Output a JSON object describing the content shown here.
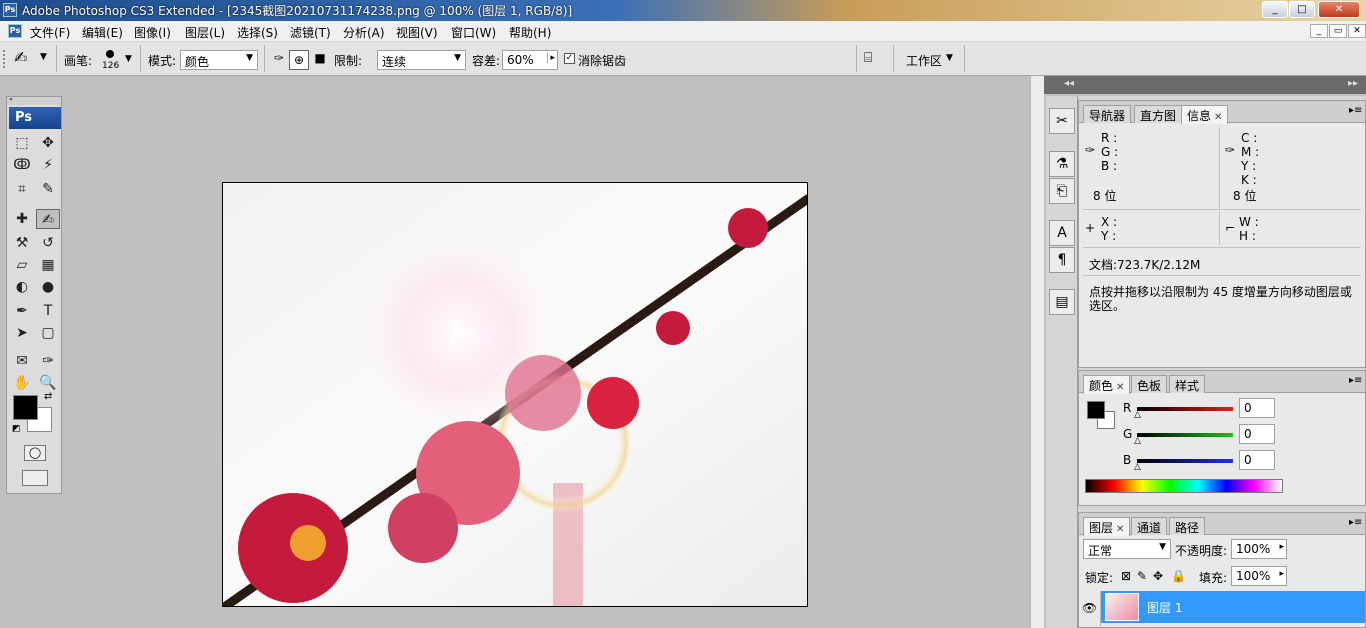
{
  "app": {
    "title": "Adobe Photoshop CS3 Extended - [2345截图20210731174238.png @ 100% (图层 1, RGB/8)]",
    "icon_label": "Ps"
  },
  "window_controls": {
    "minimize": "_",
    "maximize": "□",
    "close": "✕"
  },
  "doc_controls": {
    "minimize": "_",
    "restore": "▭",
    "close": "✕"
  },
  "menu": [
    "文件(F)",
    "编辑(E)",
    "图像(I)",
    "图层(L)",
    "选择(S)",
    "滤镜(T)",
    "分析(A)",
    "视图(V)",
    "窗口(W)",
    "帮助(H)"
  ],
  "options": {
    "brush_label": "画笔:",
    "brush_size": "126",
    "mode_label": "模式:",
    "mode_value": "颜色",
    "limit_label": "限制:",
    "limit_value": "连续",
    "tolerance_label": "容差:",
    "tolerance_value": "60%",
    "antialias_label": "消除锯齿",
    "antialias_checked": true,
    "workspace_label": "工作区"
  },
  "toolbox": {
    "logo": "Ps",
    "tools": [
      {
        "name": "marquee-tool",
        "glyph": "⬚"
      },
      {
        "name": "move-tool",
        "glyph": "✥"
      },
      {
        "name": "lasso-tool",
        "glyph": "ↂ"
      },
      {
        "name": "magic-wand-tool",
        "glyph": "⚡"
      },
      {
        "name": "crop-tool",
        "glyph": "⌗"
      },
      {
        "name": "slice-tool",
        "glyph": "✎"
      },
      {
        "name": "healing-brush-tool",
        "glyph": "✚"
      },
      {
        "name": "color-replacement-tool",
        "glyph": "✍",
        "selected": true
      },
      {
        "name": "clone-stamp-tool",
        "glyph": "⚒"
      },
      {
        "name": "history-brush-tool",
        "glyph": "↺"
      },
      {
        "name": "eraser-tool",
        "glyph": "▱"
      },
      {
        "name": "gradient-tool",
        "glyph": "▦"
      },
      {
        "name": "blur-tool",
        "glyph": "◐"
      },
      {
        "name": "dodge-tool",
        "glyph": "●"
      },
      {
        "name": "pen-tool",
        "glyph": "✒"
      },
      {
        "name": "type-tool",
        "glyph": "T"
      },
      {
        "name": "path-selection-tool",
        "glyph": "➤"
      },
      {
        "name": "shape-tool",
        "glyph": "▢"
      },
      {
        "name": "notes-tool",
        "glyph": "✉"
      },
      {
        "name": "eyedropper-tool",
        "glyph": "✑"
      },
      {
        "name": "hand-tool",
        "glyph": "✋"
      },
      {
        "name": "zoom-tool",
        "glyph": "🔍"
      }
    ],
    "foreground_color": "#000000",
    "background_color": "#ffffff"
  },
  "info_panel": {
    "tabs": [
      "导航器",
      "直方图",
      "信息"
    ],
    "active_tab": "信息",
    "rgb_labels": [
      "R :",
      "G :",
      "B :"
    ],
    "cmyk_labels": [
      "C :",
      "M :",
      "Y :",
      "K :"
    ],
    "bit_left": "8 位",
    "bit_right": "8 位",
    "x_label": "X :",
    "y_label": "Y :",
    "w_label": "W :",
    "h_label": "H :",
    "doc_text": "文档:723.7K/2.12M",
    "hint_text": "点按并拖移以沿限制为 45 度增量方向移动图层或选区。"
  },
  "color_panel": {
    "tabs": [
      "颜色",
      "色板",
      "样式"
    ],
    "active_tab": "颜色",
    "channels": [
      {
        "label": "R",
        "value": "0",
        "color": "#d02020"
      },
      {
        "label": "G",
        "value": "0",
        "color": "#20b020"
      },
      {
        "label": "B",
        "value": "0",
        "color": "#2020d0"
      }
    ]
  },
  "layers_panel": {
    "tabs": [
      "图层",
      "通道",
      "路径"
    ],
    "active_tab": "图层",
    "blend_mode": "正常",
    "opacity_label": "不透明度:",
    "opacity_value": "100%",
    "lock_label": "锁定:",
    "fill_label": "填充:",
    "fill_value": "100%",
    "layer_name": "图层 1"
  },
  "accent_color": "#3399ff"
}
